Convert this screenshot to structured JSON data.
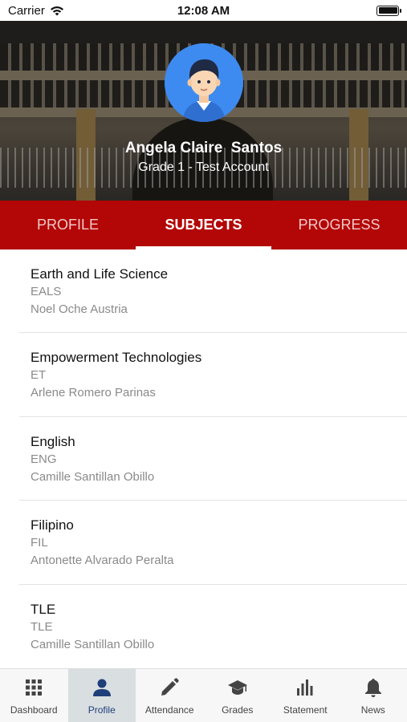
{
  "status_bar": {
    "carrier": "Carrier",
    "time": "12:08 AM",
    "battery_level": 1.0
  },
  "profile": {
    "name": "Angela Claire  Santos",
    "grade": "Grade 1 - Test Account"
  },
  "tabs": [
    {
      "label": "PROFILE",
      "active": false
    },
    {
      "label": "SUBJECTS",
      "active": true
    },
    {
      "label": "PROGRESS",
      "active": false
    }
  ],
  "subjects": [
    {
      "name": "Earth and Life Science",
      "code": "EALS",
      "teacher": "Noel Oche Austria"
    },
    {
      "name": "Empowerment Technologies",
      "code": "ET",
      "teacher": "Arlene Romero Parinas"
    },
    {
      "name": "English",
      "code": "ENG",
      "teacher": "Camille Santillan Obillo"
    },
    {
      "name": "Filipino",
      "code": "FIL",
      "teacher": "Antonette Alvarado Peralta"
    },
    {
      "name": "TLE",
      "code": "TLE",
      "teacher": "Camille Santillan Obillo"
    }
  ],
  "bottom_nav": [
    {
      "label": "Dashboard",
      "icon": "grid-icon",
      "active": false
    },
    {
      "label": "Profile",
      "icon": "person-icon",
      "active": true
    },
    {
      "label": "Attendance",
      "icon": "pencil-icon",
      "active": false
    },
    {
      "label": "Grades",
      "icon": "graduation-cap-icon",
      "active": false
    },
    {
      "label": "Statement",
      "icon": "bar-chart-icon",
      "active": false
    },
    {
      "label": "News",
      "icon": "bell-icon",
      "active": false
    }
  ],
  "colors": {
    "accent_red": "#b30606",
    "avatar_blue": "#3d8bf0",
    "nav_active_text": "#1f3f7a",
    "nav_active_bg": "#d9dee1"
  }
}
